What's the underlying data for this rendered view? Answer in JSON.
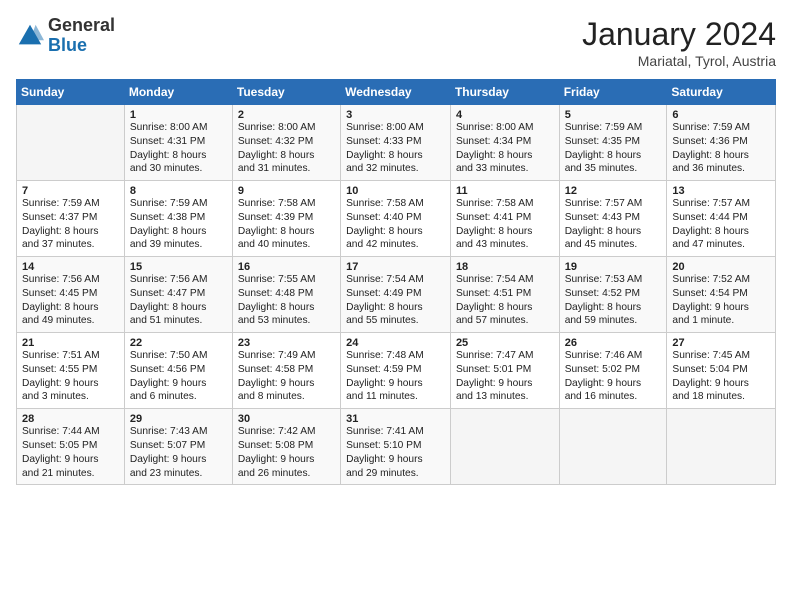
{
  "header": {
    "logo_general": "General",
    "logo_blue": "Blue",
    "month_title": "January 2024",
    "subtitle": "Mariatal, Tyrol, Austria"
  },
  "weekdays": [
    "Sunday",
    "Monday",
    "Tuesday",
    "Wednesday",
    "Thursday",
    "Friday",
    "Saturday"
  ],
  "weeks": [
    [
      {
        "num": "",
        "info": ""
      },
      {
        "num": "1",
        "info": "Sunrise: 8:00 AM\nSunset: 4:31 PM\nDaylight: 8 hours\nand 30 minutes."
      },
      {
        "num": "2",
        "info": "Sunrise: 8:00 AM\nSunset: 4:32 PM\nDaylight: 8 hours\nand 31 minutes."
      },
      {
        "num": "3",
        "info": "Sunrise: 8:00 AM\nSunset: 4:33 PM\nDaylight: 8 hours\nand 32 minutes."
      },
      {
        "num": "4",
        "info": "Sunrise: 8:00 AM\nSunset: 4:34 PM\nDaylight: 8 hours\nand 33 minutes."
      },
      {
        "num": "5",
        "info": "Sunrise: 7:59 AM\nSunset: 4:35 PM\nDaylight: 8 hours\nand 35 minutes."
      },
      {
        "num": "6",
        "info": "Sunrise: 7:59 AM\nSunset: 4:36 PM\nDaylight: 8 hours\nand 36 minutes."
      }
    ],
    [
      {
        "num": "7",
        "info": "Sunrise: 7:59 AM\nSunset: 4:37 PM\nDaylight: 8 hours\nand 37 minutes."
      },
      {
        "num": "8",
        "info": "Sunrise: 7:59 AM\nSunset: 4:38 PM\nDaylight: 8 hours\nand 39 minutes."
      },
      {
        "num": "9",
        "info": "Sunrise: 7:58 AM\nSunset: 4:39 PM\nDaylight: 8 hours\nand 40 minutes."
      },
      {
        "num": "10",
        "info": "Sunrise: 7:58 AM\nSunset: 4:40 PM\nDaylight: 8 hours\nand 42 minutes."
      },
      {
        "num": "11",
        "info": "Sunrise: 7:58 AM\nSunset: 4:41 PM\nDaylight: 8 hours\nand 43 minutes."
      },
      {
        "num": "12",
        "info": "Sunrise: 7:57 AM\nSunset: 4:43 PM\nDaylight: 8 hours\nand 45 minutes."
      },
      {
        "num": "13",
        "info": "Sunrise: 7:57 AM\nSunset: 4:44 PM\nDaylight: 8 hours\nand 47 minutes."
      }
    ],
    [
      {
        "num": "14",
        "info": "Sunrise: 7:56 AM\nSunset: 4:45 PM\nDaylight: 8 hours\nand 49 minutes."
      },
      {
        "num": "15",
        "info": "Sunrise: 7:56 AM\nSunset: 4:47 PM\nDaylight: 8 hours\nand 51 minutes."
      },
      {
        "num": "16",
        "info": "Sunrise: 7:55 AM\nSunset: 4:48 PM\nDaylight: 8 hours\nand 53 minutes."
      },
      {
        "num": "17",
        "info": "Sunrise: 7:54 AM\nSunset: 4:49 PM\nDaylight: 8 hours\nand 55 minutes."
      },
      {
        "num": "18",
        "info": "Sunrise: 7:54 AM\nSunset: 4:51 PM\nDaylight: 8 hours\nand 57 minutes."
      },
      {
        "num": "19",
        "info": "Sunrise: 7:53 AM\nSunset: 4:52 PM\nDaylight: 8 hours\nand 59 minutes."
      },
      {
        "num": "20",
        "info": "Sunrise: 7:52 AM\nSunset: 4:54 PM\nDaylight: 9 hours\nand 1 minute."
      }
    ],
    [
      {
        "num": "21",
        "info": "Sunrise: 7:51 AM\nSunset: 4:55 PM\nDaylight: 9 hours\nand 3 minutes."
      },
      {
        "num": "22",
        "info": "Sunrise: 7:50 AM\nSunset: 4:56 PM\nDaylight: 9 hours\nand 6 minutes."
      },
      {
        "num": "23",
        "info": "Sunrise: 7:49 AM\nSunset: 4:58 PM\nDaylight: 9 hours\nand 8 minutes."
      },
      {
        "num": "24",
        "info": "Sunrise: 7:48 AM\nSunset: 4:59 PM\nDaylight: 9 hours\nand 11 minutes."
      },
      {
        "num": "25",
        "info": "Sunrise: 7:47 AM\nSunset: 5:01 PM\nDaylight: 9 hours\nand 13 minutes."
      },
      {
        "num": "26",
        "info": "Sunrise: 7:46 AM\nSunset: 5:02 PM\nDaylight: 9 hours\nand 16 minutes."
      },
      {
        "num": "27",
        "info": "Sunrise: 7:45 AM\nSunset: 5:04 PM\nDaylight: 9 hours\nand 18 minutes."
      }
    ],
    [
      {
        "num": "28",
        "info": "Sunrise: 7:44 AM\nSunset: 5:05 PM\nDaylight: 9 hours\nand 21 minutes."
      },
      {
        "num": "29",
        "info": "Sunrise: 7:43 AM\nSunset: 5:07 PM\nDaylight: 9 hours\nand 23 minutes."
      },
      {
        "num": "30",
        "info": "Sunrise: 7:42 AM\nSunset: 5:08 PM\nDaylight: 9 hours\nand 26 minutes."
      },
      {
        "num": "31",
        "info": "Sunrise: 7:41 AM\nSunset: 5:10 PM\nDaylight: 9 hours\nand 29 minutes."
      },
      {
        "num": "",
        "info": ""
      },
      {
        "num": "",
        "info": ""
      },
      {
        "num": "",
        "info": ""
      }
    ]
  ]
}
